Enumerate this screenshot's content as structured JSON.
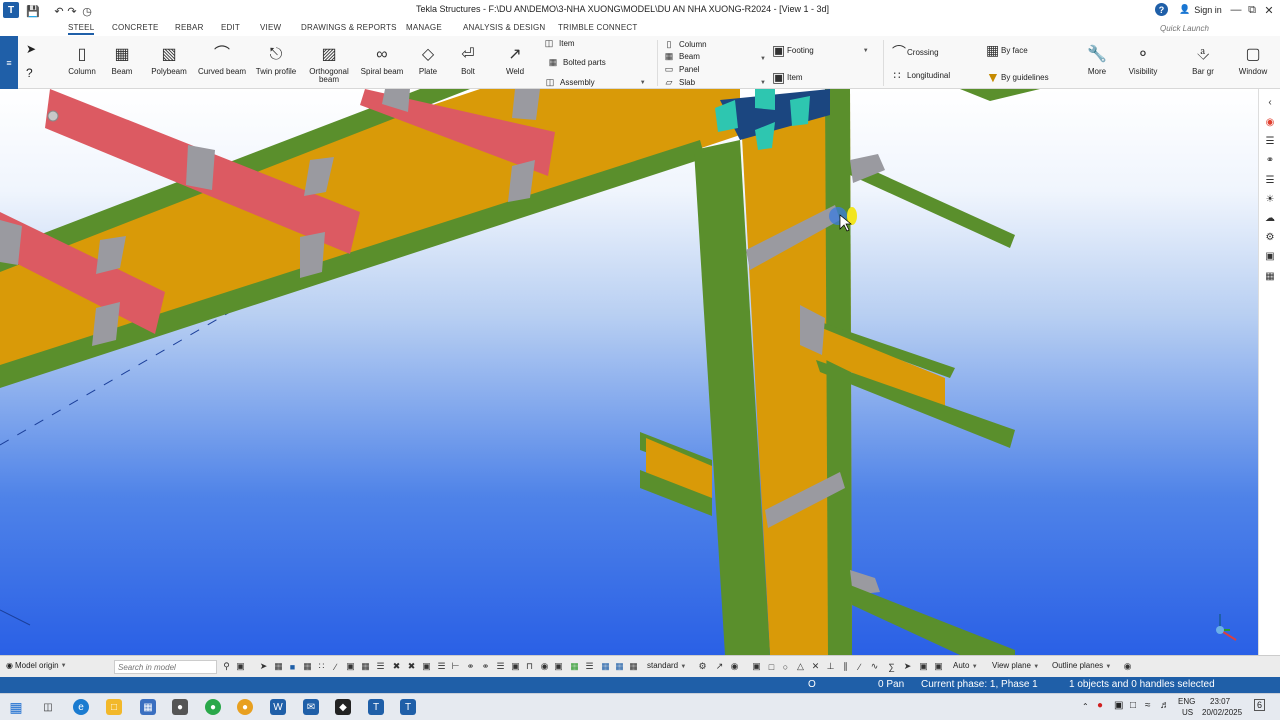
{
  "titlebar": {
    "title": "Tekla Structures - F:\\DU AN\\DEMO\\3-NHA XUONG\\MODEL\\DU AN NHA XUONG-R2024 - [View 1 - 3d]",
    "sign_in": "Sign in"
  },
  "menu": {
    "tabs": [
      "STEEL",
      "CONCRETE",
      "REBAR",
      "EDIT",
      "VIEW",
      "DRAWINGS & REPORTS",
      "MANAGE",
      "ANALYSIS & DESIGN",
      "TRIMBLE CONNECT"
    ],
    "active": "STEEL",
    "quick_launch_placeholder": "Quick Launch"
  },
  "ribbon": {
    "steel_buttons": [
      "Column",
      "Beam",
      "Polybeam",
      "Curved beam",
      "Twin profile",
      "Orthogonal beam",
      "Spiral beam",
      "Plate",
      "Bolt",
      "Weld"
    ],
    "item_group": [
      "Item",
      "Bolted parts",
      "Assembly"
    ],
    "concrete_group": [
      "Column",
      "Beam",
      "Panel",
      "Slab"
    ],
    "footing_label": "Footing",
    "item_label": "Item",
    "rebar_group": [
      "Crossing",
      "Longitudinal",
      "By face",
      "By guidelines"
    ],
    "more_label": "More",
    "visibility_label": "Visibility",
    "bar_label": "Bar gr",
    "window_label": "Window"
  },
  "bottombar": {
    "model_origin": "Model origin",
    "search_placeholder": "Search in model",
    "standard": "standard",
    "auto": "Auto",
    "view_plane": "View plane",
    "outline_planes": "Outline planes"
  },
  "statusbar": {
    "o": "O",
    "pan": "0 Pan",
    "phase": "Current phase: 1, Phase 1",
    "selection": "1 objects and 0 handles selected"
  },
  "taskbar": {
    "lang": "ENG",
    "region": "US",
    "time": "23:07",
    "date": "20/02/2025",
    "notifications": "6"
  },
  "colors": {
    "accent": "#1f5fa8",
    "steel_green": "#5a8f2c",
    "steel_orange": "#d99a08",
    "steel_red": "#dc5a62",
    "steel_gray": "#9a9aa0"
  }
}
